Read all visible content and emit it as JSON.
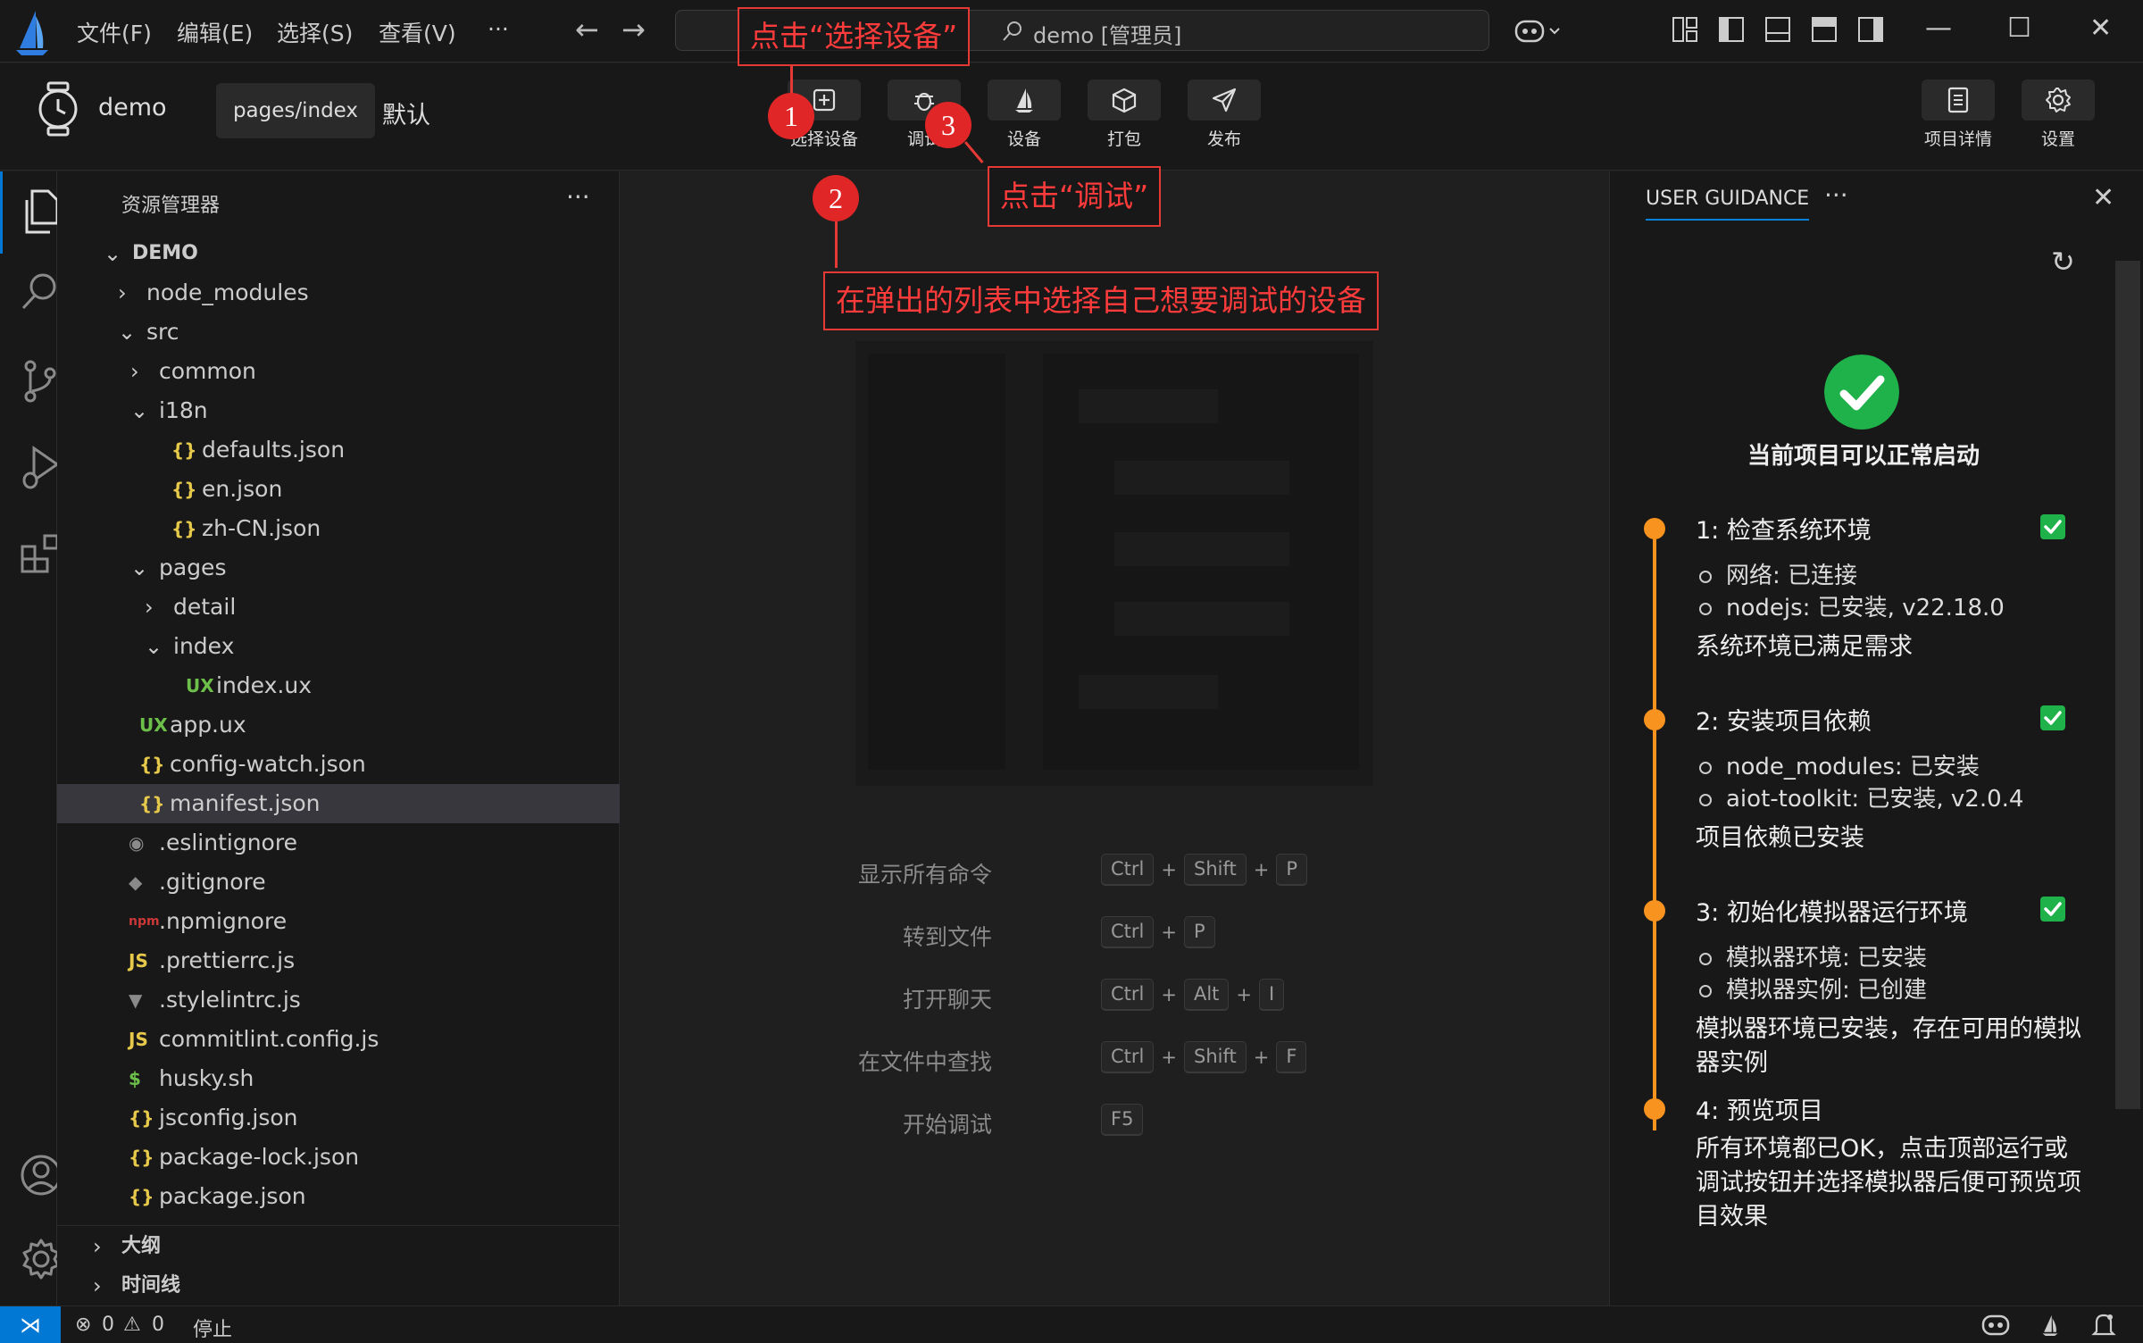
{
  "titlebar": {
    "menus": [
      "文件(F)",
      "编辑(E)",
      "选择(S)",
      "查看(V)"
    ],
    "more": "···",
    "search_text": "demo [管理员]"
  },
  "toolbar": {
    "project_name": "demo",
    "page_tab": "pages/index",
    "default_label": "默认",
    "buttons": [
      "选择设备",
      "调试",
      "设备",
      "打包",
      "发布"
    ],
    "right_buttons": [
      "项目详情",
      "设置"
    ]
  },
  "explorer": {
    "title": "资源管理器",
    "more": "···",
    "tree": [
      {
        "name": "DEMO",
        "icon": "",
        "chev": "v"
      },
      {
        "name": "node_modules",
        "icon": "",
        "chev": ">"
      },
      {
        "name": "src",
        "icon": "",
        "chev": "v"
      },
      {
        "name": "common",
        "icon": "",
        "chev": ">"
      },
      {
        "name": "i18n",
        "icon": "",
        "chev": "v"
      },
      {
        "name": "defaults.json",
        "icon": "{}",
        "chev": ""
      },
      {
        "name": "en.json",
        "icon": "{}",
        "chev": ""
      },
      {
        "name": "zh-CN.json",
        "icon": "{}",
        "chev": ""
      },
      {
        "name": "pages",
        "icon": "",
        "chev": "v"
      },
      {
        "name": "detail",
        "icon": "",
        "chev": ">"
      },
      {
        "name": "index",
        "icon": "",
        "chev": "v"
      },
      {
        "name": "index.ux",
        "icon": "UX",
        "chev": ""
      },
      {
        "name": "app.ux",
        "icon": "UX",
        "chev": ""
      },
      {
        "name": "config-watch.json",
        "icon": "{}",
        "chev": ""
      },
      {
        "name": "manifest.json",
        "icon": "{}",
        "chev": ""
      },
      {
        "name": ".eslintignore",
        "icon": "eslint-icon",
        "chev": ""
      },
      {
        "name": ".gitignore",
        "icon": "git-icon",
        "chev": ""
      },
      {
        "name": ".npmignore",
        "icon": "npm-icon",
        "chev": ""
      },
      {
        "name": ".prettierrc.js",
        "icon": "JS",
        "chev": ""
      },
      {
        "name": ".stylelintrc.js",
        "icon": "stylelint-icon",
        "chev": ""
      },
      {
        "name": "commitlint.config.js",
        "icon": "JS",
        "chev": ""
      },
      {
        "name": "husky.sh",
        "icon": "$",
        "chev": ""
      },
      {
        "name": "jsconfig.json",
        "icon": "{}",
        "chev": ""
      },
      {
        "name": "package-lock.json",
        "icon": "{}",
        "chev": ""
      },
      {
        "name": "package.json",
        "icon": "{}",
        "chev": ""
      }
    ],
    "sections": [
      "大纲",
      "时间线"
    ]
  },
  "editor": {
    "shortcuts": [
      {
        "label": "显示所有命令",
        "keys": [
          "Ctrl",
          "Shift",
          "P"
        ]
      },
      {
        "label": "转到文件",
        "keys": [
          "Ctrl",
          "P"
        ]
      },
      {
        "label": "打开聊天",
        "keys": [
          "Ctrl",
          "Alt",
          "I"
        ]
      },
      {
        "label": "在文件中查找",
        "keys": [
          "Ctrl",
          "Shift",
          "F"
        ]
      },
      {
        "label": "开始调试",
        "keys": [
          "F5"
        ]
      }
    ]
  },
  "guidance": {
    "title": "USER GUIDANCE",
    "more": "···",
    "status": "当前项目可以正常启动",
    "steps": [
      {
        "title": "1: 检查系统环境",
        "items": [
          "网络: 已连接",
          "nodejs: 已安装, v22.18.0"
        ],
        "summary": "系统环境已满足需求",
        "checked": true
      },
      {
        "title": "2: 安装项目依赖",
        "items": [
          "node_modules: 已安装",
          "aiot-toolkit: 已安装, v2.0.4"
        ],
        "summary": "项目依赖已安装",
        "checked": true
      },
      {
        "title": "3: 初始化模拟器运行环境",
        "items": [
          "模拟器环境: 已安装",
          "模拟器实例: 已创建"
        ],
        "summary": "模拟器环境已安装，存在可用的模拟器实例",
        "checked": true
      },
      {
        "title": "4: 预览项目",
        "items": [],
        "summary": "所有环境都已OK，点击顶部运行或调试按钮并选择模拟器后便可预览项目效果",
        "checked": false
      }
    ]
  },
  "statusbar": {
    "errors": "0",
    "warnings": "0",
    "stop": "停止"
  },
  "annotations": {
    "a1": "点击“选择设备”",
    "a2": "在弹出的列表中选择自己想要调试的设备",
    "a3": "点击“调试”",
    "n1": "1",
    "n2": "2",
    "n3": "3"
  },
  "colors": {
    "accent": "#0078d4",
    "orange": "#f7931e",
    "green": "#1fb24a",
    "annotation_red": "#e53935"
  }
}
